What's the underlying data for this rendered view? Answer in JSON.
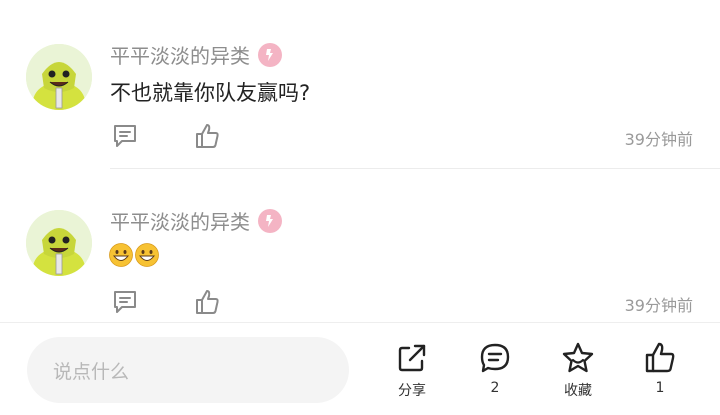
{
  "comments": [
    {
      "username": "平平淡淡的异类",
      "text": "不也就靠你队友赢吗?",
      "emoji": [],
      "time": "39分钟前"
    },
    {
      "username": "平平淡淡的异类",
      "text": "",
      "emoji": [
        "grinning-face",
        "grinning-face"
      ],
      "time": "39分钟前"
    }
  ],
  "bottom_bar": {
    "input_placeholder": "说点什么",
    "share_label": "分享",
    "comment_count": "2",
    "favorite_label": "收藏",
    "like_count": "1"
  },
  "colors": {
    "username": "#8d8d8d",
    "badge": "#f0a3b7",
    "avatar_green": "#c9d93a",
    "time": "#9a9a9a"
  }
}
